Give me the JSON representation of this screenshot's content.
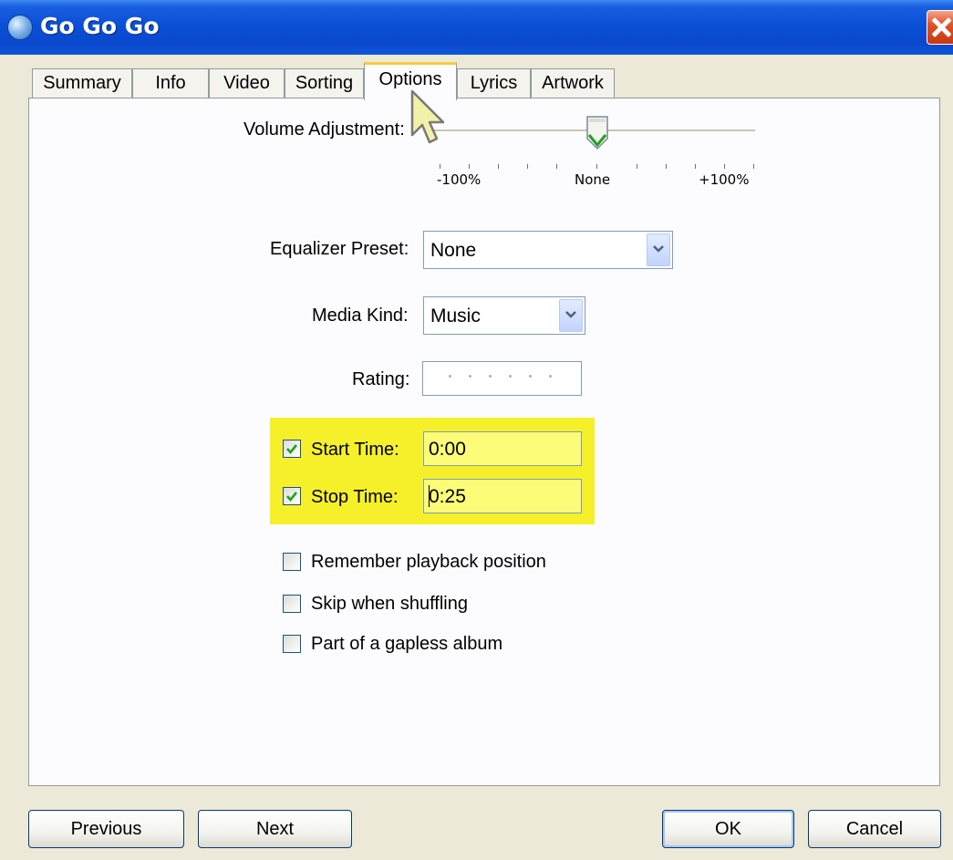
{
  "window": {
    "title": "Go Go Go"
  },
  "tabs": [
    {
      "label": "Summary"
    },
    {
      "label": "Info"
    },
    {
      "label": "Video"
    },
    {
      "label": "Sorting"
    },
    {
      "label": "Options"
    },
    {
      "label": "Lyrics"
    },
    {
      "label": "Artwork"
    }
  ],
  "active_tab": "Options",
  "volume": {
    "label": "Volume Adjustment:",
    "min_label": "-100%",
    "mid_label": "None",
    "max_label": "+100%",
    "value_percent": 0
  },
  "equalizer": {
    "label": "Equalizer Preset:",
    "value": "None"
  },
  "media_kind": {
    "label": "Media Kind:",
    "value": "Music"
  },
  "rating": {
    "label": "Rating:",
    "stars": 0
  },
  "start_time": {
    "label": "Start Time:",
    "checked": true,
    "value": "0:00"
  },
  "stop_time": {
    "label": "Stop Time:",
    "checked": true,
    "value": "0:25"
  },
  "options": [
    {
      "label": "Remember playback position",
      "checked": false
    },
    {
      "label": "Skip when shuffling",
      "checked": false
    },
    {
      "label": "Part of a gapless album",
      "checked": false
    }
  ],
  "buttons": {
    "previous": "Previous",
    "next": "Next",
    "ok": "OK",
    "cancel": "Cancel"
  },
  "colors": {
    "highlight": "#f6f02a",
    "title_bar": "#0a4fd8",
    "check_green": "#21a121"
  }
}
